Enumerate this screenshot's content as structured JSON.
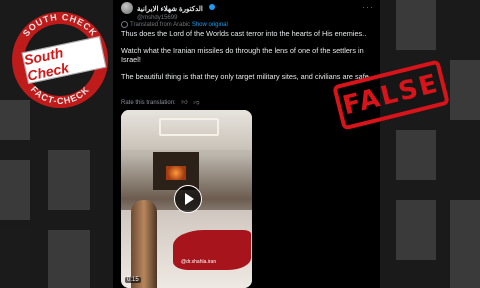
{
  "post": {
    "display_name": "الدكتورة شهلاء الايرانية",
    "handle": "@mshdy15699",
    "translated_label": "Translated from Arabic",
    "show_original": "Show original",
    "paragraph1": "Thus does the Lord of the Worlds cast terror into the hearts of His enemies..",
    "paragraph2": "Watch what the Iranian missiles do through the lens of one of the settlers in Israel!",
    "paragraph3": "The beautiful thing is that they only target military sites, and civilians are safe.",
    "rate_label": "Rate this translation:",
    "video_time": "0:15",
    "watermark": "@dr.shahla.iran"
  },
  "logo": {
    "ring_top": "SOUTH CHECK",
    "ring_bottom": "FACT-CHECK",
    "banner": "South Check"
  },
  "stamp": {
    "label": "FALSE",
    "color": "#d8141a"
  },
  "icons": [
    "avatar",
    "verified-badge-icon",
    "more-icon",
    "globe-icon",
    "thumbs-up-icon",
    "thumbs-down-icon",
    "play-icon"
  ]
}
